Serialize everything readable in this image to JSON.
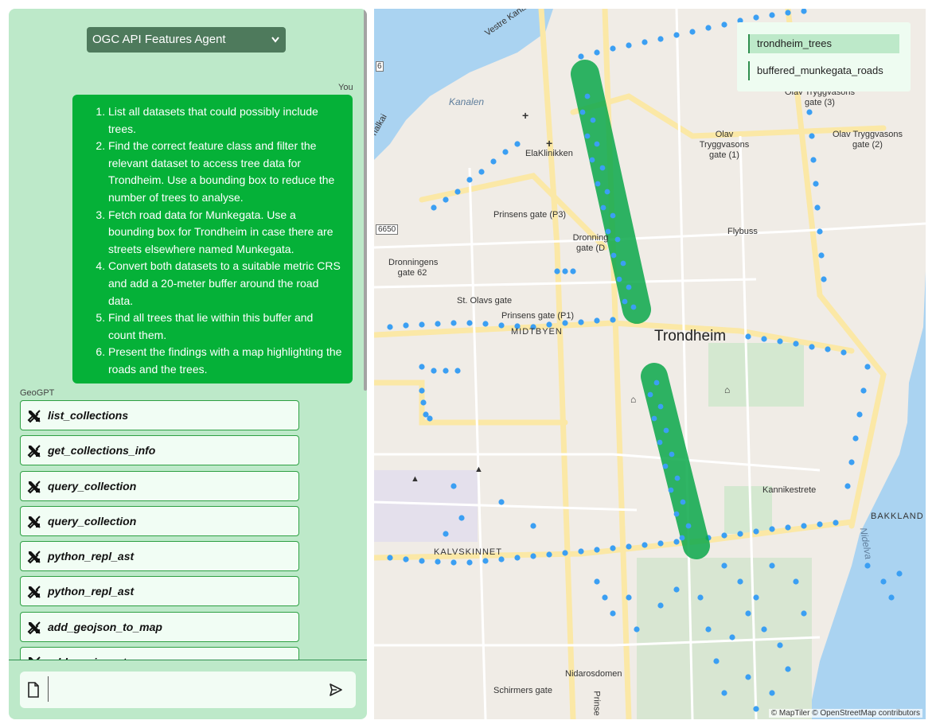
{
  "chat": {
    "agent_selector": "OGC API Features Agent",
    "user_label": "You",
    "assistant_label": "GeoGPT",
    "user_steps": [
      "List all datasets that could possibly include trees.",
      "Find the correct feature class and filter the relevant dataset to access tree data for Trondheim. Use a bounding box to reduce the number of trees to analyse.",
      "Fetch road data for Munkegata. Use a bounding box for Trondheim in case there are streets elsewhere named Munkegata.",
      "Convert both datasets to a suitable metric CRS and add a 20-meter buffer around the road data.",
      "Find all trees that lie within this buffer and count them.",
      "Present the findings with a map highlighting the roads and the trees."
    ],
    "tool_calls": [
      "list_collections",
      "get_collections_info",
      "query_collection",
      "query_collection",
      "python_repl_ast",
      "python_repl_ast",
      "add_geojson_to_map",
      "add_geojson_to_map"
    ],
    "input_placeholder": ""
  },
  "map": {
    "layers": [
      {
        "name": "trondheim_trees",
        "active": true
      },
      {
        "name": "buffered_munkegata_roads",
        "active": false
      }
    ],
    "colors": {
      "trees": "#3b9ff3",
      "buffer": "#0aa84a",
      "water": "#aad3f1",
      "road": "#fbe8a6",
      "park": "#d4e8d0"
    },
    "labels": {
      "kanalen": "Kanalen",
      "elaklinikken": "ElaKlinikken",
      "prinsens_p3": "Prinsens gate (P3)",
      "dronningens_62": "Dronningens gate 62",
      "dronningens_d": "Dronning gate (D",
      "st_olavs": "St. Olavs gate",
      "prinsens_p1": "Prinsens gate (P1)",
      "midtbyen": "MIDTBYEN",
      "trondheim": "Trondheim",
      "olav_1": "Olav Tryggvasons gate (1)",
      "olav_2": "Olav Tryggvasons gate (2)",
      "olav_3": "Olav Tryggvasons gate (3)",
      "fylbuss": "Flybuss",
      "kannikestrete": "Kannikestrete",
      "bakklandet": "BAKKLAND",
      "nidelva": "Nidelva",
      "kalvskinnet": "KALVSKINNET",
      "nidarosdomen": "Nidarosdomen",
      "schirmers": "Schirmers gate",
      "vestre_kanalkai": "Vestre Kanal",
      "road_6650": "6650",
      "prinsens_vert": "Prinse",
      "kanalkai_left": "nalkai",
      "road_6": "6"
    },
    "attribution": "© MapTiler © OpenStreetMap contributors"
  }
}
